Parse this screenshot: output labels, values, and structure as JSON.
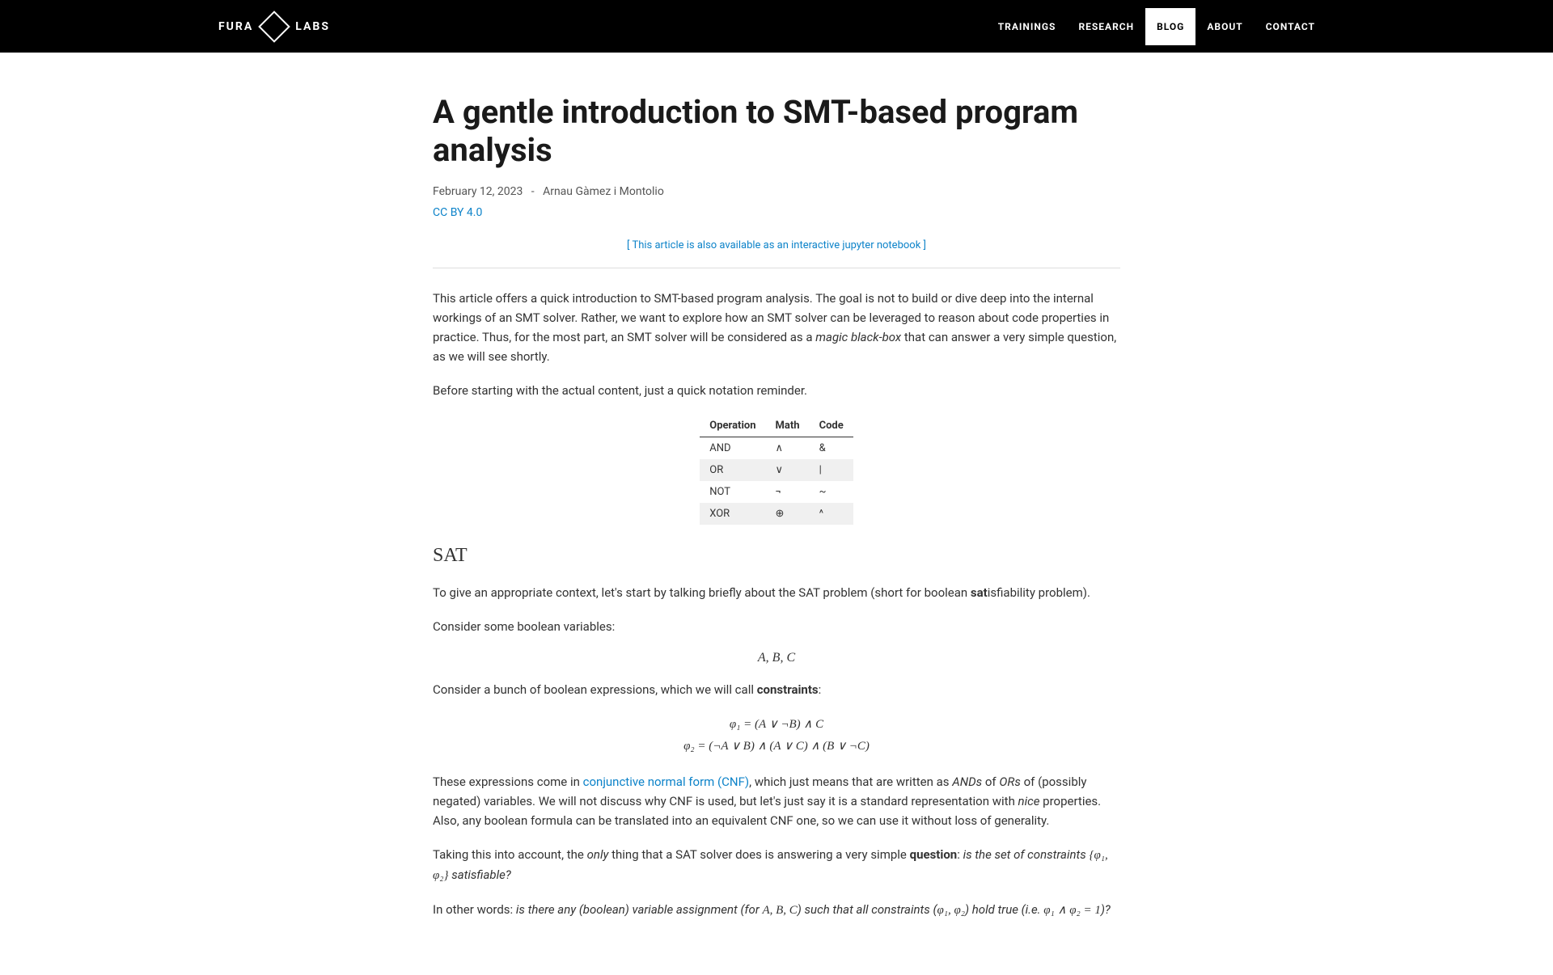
{
  "header": {
    "logo_left": "FURA",
    "logo_right": "LABS",
    "nav": [
      {
        "label": "TRAININGS",
        "active": false
      },
      {
        "label": "RESEARCH",
        "active": false
      },
      {
        "label": "BLOG",
        "active": true
      },
      {
        "label": "ABOUT",
        "active": false
      },
      {
        "label": "CONTACT",
        "active": false
      }
    ]
  },
  "article": {
    "title": "A gentle introduction to SMT-based program analysis",
    "date": "February 12, 2023",
    "separator": "-",
    "author": "Arnau Gàmez i Montolio",
    "license": "CC BY 4.0",
    "notebook_link": "[ This article is also available as an interactive jupyter notebook ]",
    "intro_p1_a": "This article offers a quick introduction to SMT-based program analysis. The goal is not to build or dive deep into the internal workings of an SMT solver. Rather, we want to explore how an SMT solver can be leveraged to reason about code properties in practice. Thus, for the most part, an SMT solver will be considered as a ",
    "intro_p1_b": "magic black-box",
    "intro_p1_c": " that can answer a very simple question, as we will see shortly.",
    "intro_p2": "Before starting with the actual content, just a quick notation reminder.",
    "table": {
      "headers": [
        "Operation",
        "Math",
        "Code"
      ],
      "rows": [
        [
          "AND",
          "∧",
          "&"
        ],
        [
          "OR",
          "∨",
          "|"
        ],
        [
          "NOT",
          "¬",
          "~"
        ],
        [
          "XOR",
          "⊕",
          "^"
        ]
      ]
    },
    "sat_heading": "SAT",
    "sat_p1_a": "To give an appropriate context, let's start by talking briefly about the SAT problem (short for boolean ",
    "sat_p1_b": "sat",
    "sat_p1_c": "isfiability problem).",
    "sat_p2": "Consider some boolean variables:",
    "formula1": "A, B, C",
    "sat_p3_a": "Consider a bunch of boolean expressions, which we will call ",
    "sat_p3_b": "constraints",
    "sat_p3_c": ":",
    "formula2_line1": "φ₁ = (A ∨ ¬B) ∧ C",
    "formula2_line2": "φ₂ = (¬A ∨ B) ∧ (A ∨ C) ∧ (B ∨ ¬C)",
    "sat_p4_a": "These expressions come in ",
    "sat_p4_b": "conjunctive normal form (CNF)",
    "sat_p4_c": ", which just means that are written as ",
    "sat_p4_d": "ANDs",
    "sat_p4_e": " of ",
    "sat_p4_f": "ORs",
    "sat_p4_g": " of (possibly negated) variables. We will not discuss why CNF is used, but let's just say it is a standard representation with ",
    "sat_p4_h": "nice",
    "sat_p4_i": " properties. Also, any boolean formula can be translated into an equivalent CNF one, so we can use it without loss of generality.",
    "sat_p5_a": "Taking this into account, the ",
    "sat_p5_b": "only",
    "sat_p5_c": " thing that a SAT solver does is answering a very simple ",
    "sat_p5_d": "question",
    "sat_p5_e": ": ",
    "sat_p5_f": "is the set of constraints ",
    "sat_p5_g": "{φ₁, φ₂}",
    "sat_p5_h": " satisfiable?",
    "sat_p6_a": "In other words: ",
    "sat_p6_b": "is there any (boolean) variable assignment (for ",
    "sat_p6_c": "A, B, C",
    "sat_p6_d": ") such that all constraints (",
    "sat_p6_e": "φ₁, φ₂",
    "sat_p6_f": ") hold true (i.e. ",
    "sat_p6_g": "φ₁ ∧ φ₂ = 1",
    "sat_p6_h": ")?"
  }
}
